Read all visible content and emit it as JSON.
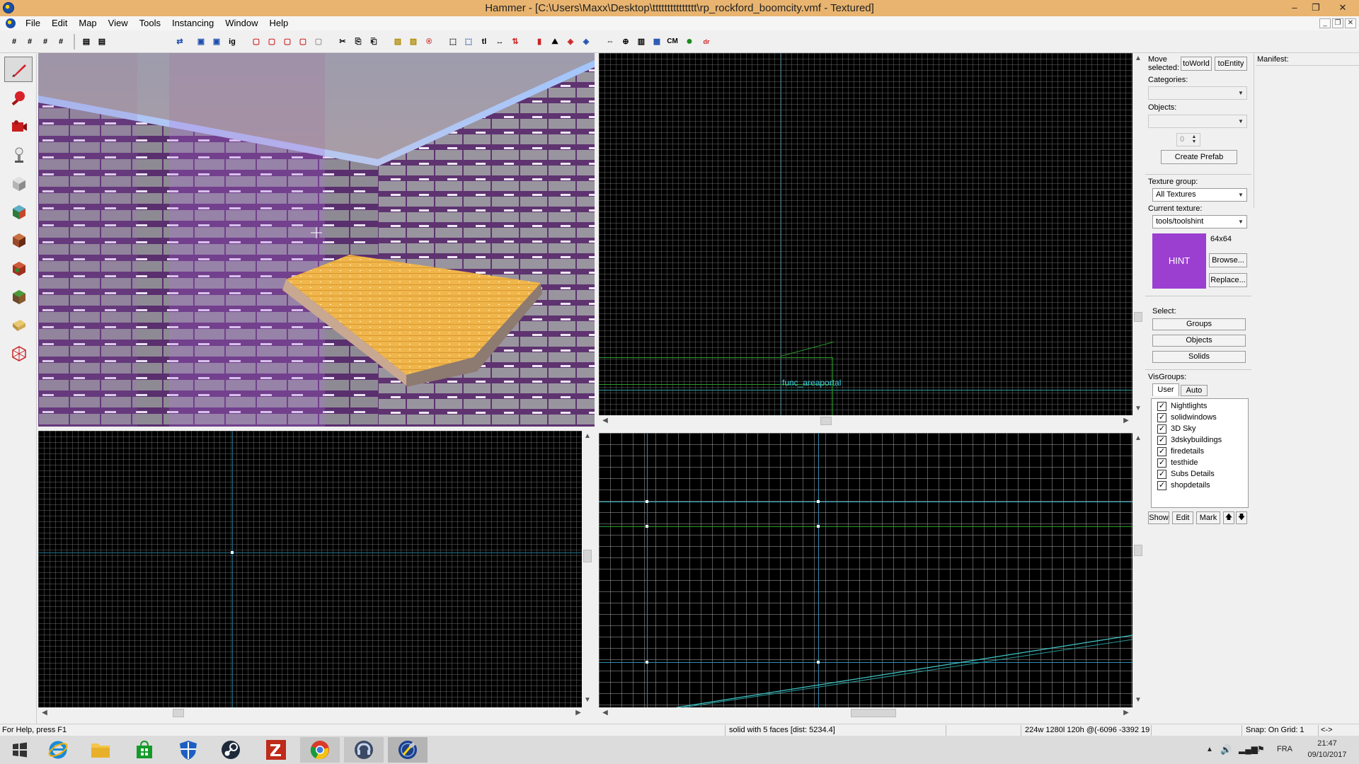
{
  "window": {
    "title": "Hammer - [C:\\Users\\Maxx\\Desktop\\ttttttttttttttt\\rp_rockford_boomcity.vmf - Textured]",
    "minimize": "–",
    "restore": "❐",
    "close": "✕"
  },
  "menu": [
    "File",
    "Edit",
    "Map",
    "View",
    "Tools",
    "Instancing",
    "Window",
    "Help"
  ],
  "mdi_controls": [
    "_",
    "❐",
    "✕"
  ],
  "toolbar_glyphs": [
    "#",
    "#",
    "#",
    "#",
    "▤",
    "▤",
    "⇄",
    "▣",
    "▣",
    "ig",
    "▢",
    "▢",
    "▢",
    "▢",
    "▢",
    "✂",
    "⎘",
    "⎗",
    "▨",
    "▨",
    "®",
    "⬚",
    "⬚",
    "tl",
    "↔",
    "⇅",
    "▮",
    "⛰",
    "◈",
    "◈",
    "⇔",
    "⊕",
    "▥",
    "▩",
    "CM",
    "●",
    "dr"
  ],
  "tools": [
    "selection-tool",
    "magnify-tool",
    "camera-tool",
    "entity-tool",
    "block-tool",
    "texture-application-tool",
    "apply-texture-tool",
    "decal-tool",
    "overlay-tool",
    "clipping-tool",
    "vertex-tool"
  ],
  "viewport_2d_top": {
    "entity_label": "func_areaportal"
  },
  "right_panel": {
    "move_selected_label": "Move selected:",
    "to_world": "toWorld",
    "to_entity": "toEntity",
    "categories_label": "Categories:",
    "objects_label": "Objects:",
    "spinner_value": "0",
    "create_prefab": "Create Prefab",
    "texture_group_label": "Texture group:",
    "texture_group_value": "All Textures",
    "current_texture_label": "Current texture:",
    "current_texture_value": "tools/toolshint",
    "texture_size": "64x64",
    "texture_preview_text": "HINT",
    "texture_preview_color": "#9b3fd0",
    "browse": "Browse...",
    "replace": "Replace...",
    "select_label": "Select:",
    "groups": "Groups",
    "objects": "Objects",
    "solids": "Solids",
    "visgroups_label": "VisGroups:",
    "tab_user": "User",
    "tab_auto": "Auto",
    "visgroups": [
      "Nightlights",
      "solidwindows",
      "3D Sky",
      "3dskybuildings",
      "firedetails",
      "testhide",
      "Subs Details",
      "shopdetails"
    ],
    "show": "Show",
    "edit": "Edit",
    "mark": "Mark",
    "up": "🡅",
    "down": "🡇"
  },
  "manifest": {
    "label": "Manifest:"
  },
  "status": {
    "help": "For Help, press F1",
    "selection": "solid with 5 faces  [dist: 5234.4]",
    "size": "224w 1280l 120h @(-6096 -3392 19",
    "snap": "Snap: On Grid: 1",
    "arrows": "<->"
  },
  "taskbar": {
    "apps": [
      "start",
      "internet-explorer",
      "file-explorer",
      "store",
      "defender",
      "steam",
      "filezilla",
      "chrome",
      "teamspeak",
      "hammer"
    ],
    "language": "FRA",
    "time": "21:47",
    "date": "09/10/2017"
  }
}
